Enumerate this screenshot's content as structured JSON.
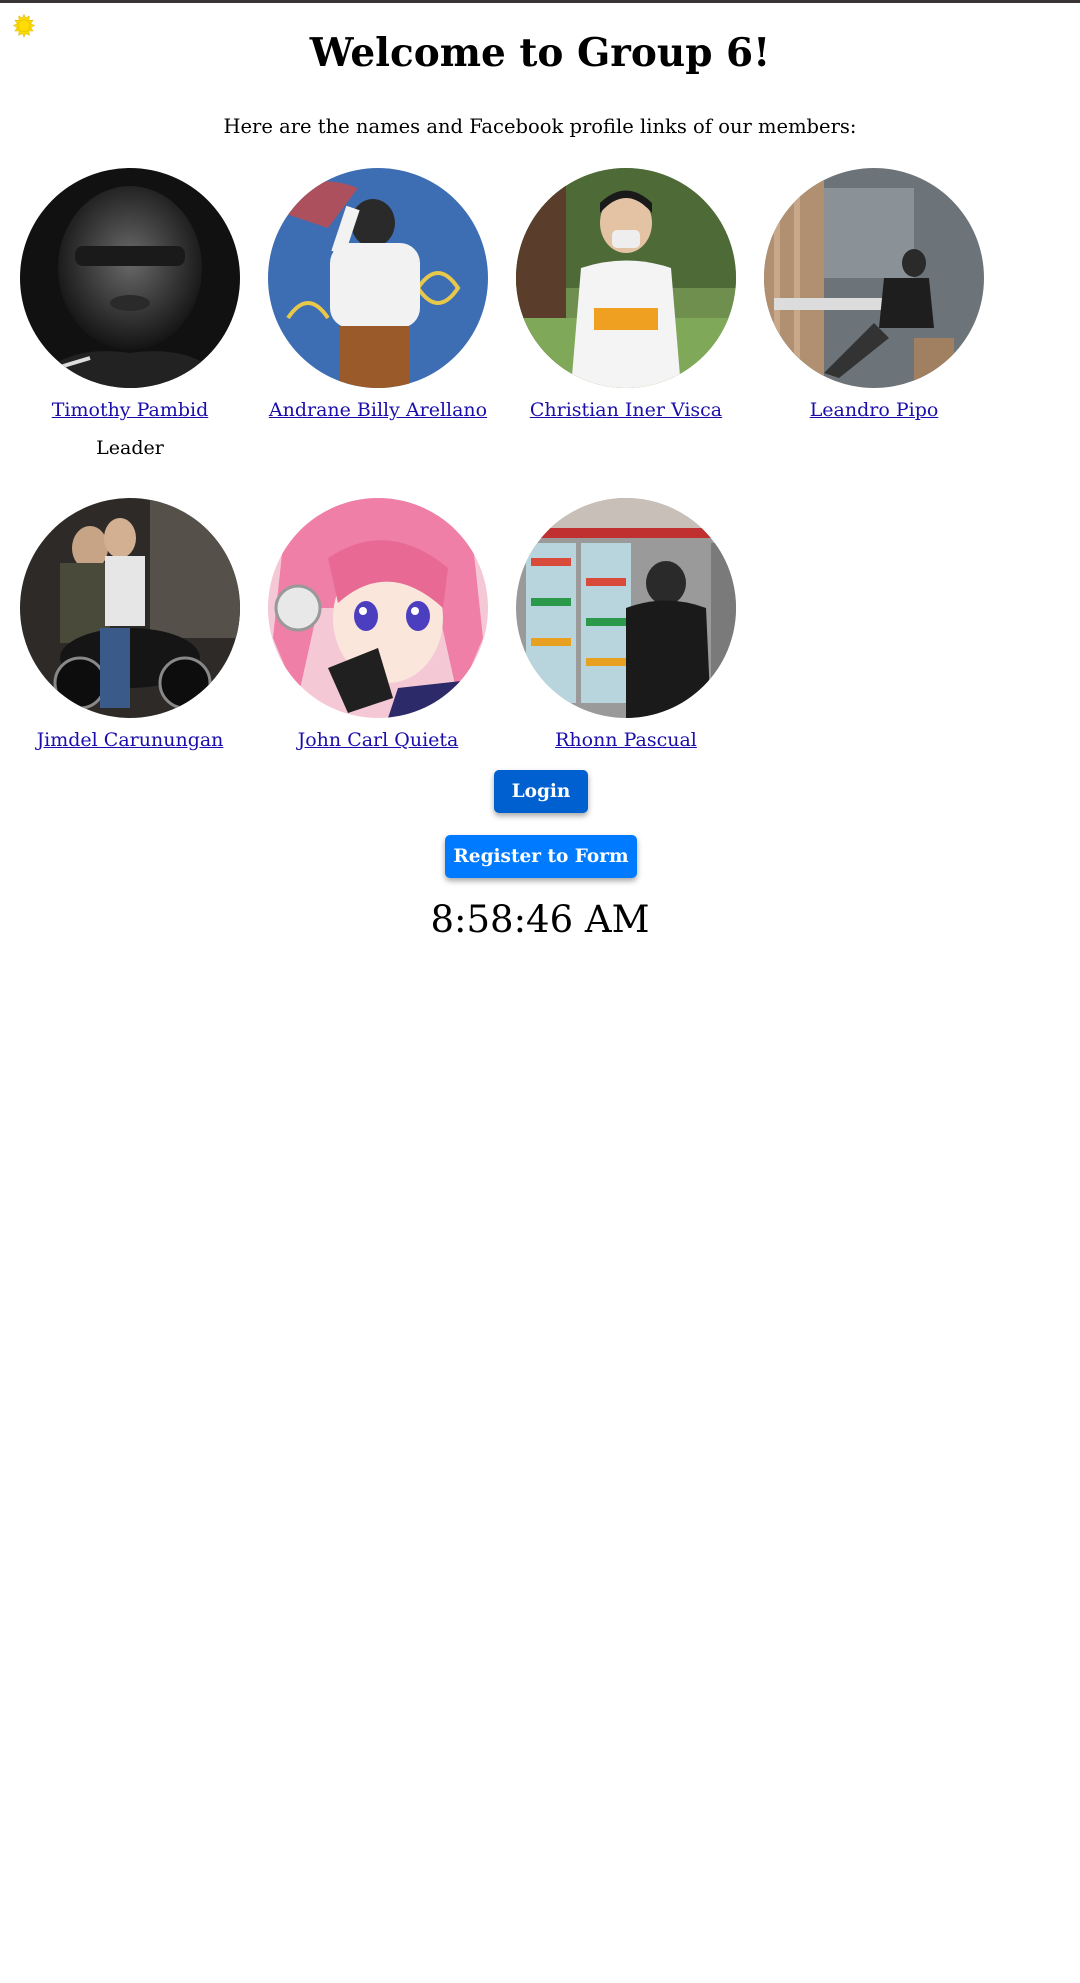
{
  "header": {
    "title": "Welcome to Group 6!",
    "intro": "Here are the names and Facebook profile links of our members:"
  },
  "theme_toggle": {
    "icon": "sun-icon",
    "color": "#ffdd00"
  },
  "members": [
    {
      "name": "Timothy Pambid",
      "role": "Leader"
    },
    {
      "name": "Andrane Billy Arellano"
    },
    {
      "name": "Christian Iner Visca"
    },
    {
      "name": "Leandro Pipo"
    },
    {
      "name": "Jimdel Carunungan"
    },
    {
      "name": "John Carl Quieta"
    },
    {
      "name": "Rhonn Pascual"
    }
  ],
  "actions": {
    "login_label": "Login",
    "register_label": "Register to Form"
  },
  "clock": {
    "time": "8:58:46 AM"
  },
  "colors": {
    "link": "#1a0dab",
    "login_button": "#0060d0",
    "register_button": "#007bff"
  }
}
